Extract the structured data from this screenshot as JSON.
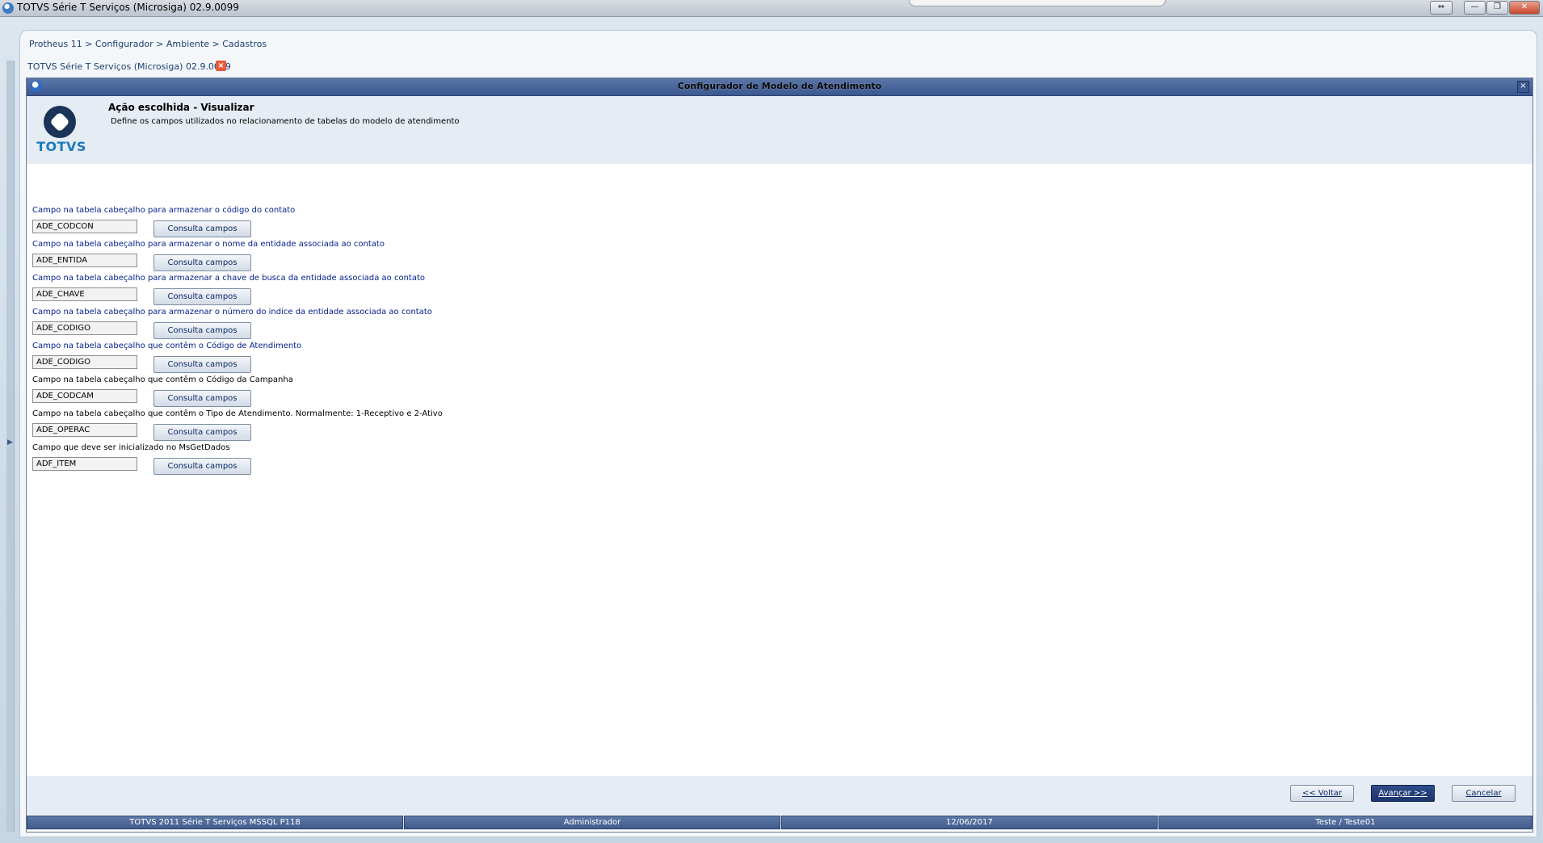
{
  "os_window": {
    "title": "TOTVS Série T Serviços (Microsiga) 02.9.0099",
    "buttons": [
      "⇔",
      "—",
      "❐",
      "✕"
    ]
  },
  "breadcrumb": "Protheus 11 > Configurador > Ambiente > Cadastros",
  "doc_tab": {
    "label": "TOTVS Série T Serviços (Microsiga) 02.9.0099",
    "close": "×"
  },
  "dialog": {
    "title": "Configurador de Modelo de Atendimento",
    "close": "×",
    "header": {
      "logo_text": "TOTVS",
      "title": "Ação escolhida - Visualizar",
      "description": "Define os campos utilizados no relacionamento de tabelas do modelo de atendimento"
    },
    "consulta_label": "Consulta campos",
    "fields": [
      {
        "label": "Campo na tabela cabeçalho para armazenar o código do contato",
        "value": "ADE_CODCON"
      },
      {
        "label": "Campo na tabela cabeçalho para armazenar o nome da entidade associada ao contato",
        "value": "ADE_ENTIDA"
      },
      {
        "label": "Campo na tabela cabeçalho para armazenar a chave de busca da entidade associada ao contato",
        "value": "ADE_CHAVE"
      },
      {
        "label": "Campo na tabela cabeçalho para armazenar o número do indice da entidade associada ao contato",
        "value": "ADE_CODIGO"
      },
      {
        "label": "Campo na tabela cabeçalho que contêm o Código de Atendimento",
        "value": "ADE_CODIGO"
      },
      {
        "label": "Campo na tabela cabeçalho que contêm o Código da Campanha",
        "value": "ADE_CODCAM"
      },
      {
        "label": "Campo na tabela cabeçalho que contêm o Tipo de Atendimento. Normalmente: 1-Receptivo e 2-Ativo",
        "value": "ADE_OPERAC"
      },
      {
        "label": "Campo que deve ser inicializado no MsGetDados",
        "value": "ADF_ITEM"
      }
    ],
    "buttons": {
      "back": "<< Voltar",
      "next": "Avançar >>",
      "cancel": "Cancelar"
    }
  },
  "statusbar": {
    "system": "TOTVS 2011 Série T Serviços MSSQL P118",
    "user": "Administrador",
    "date": "12/06/2017",
    "company": "Teste / Teste01"
  }
}
